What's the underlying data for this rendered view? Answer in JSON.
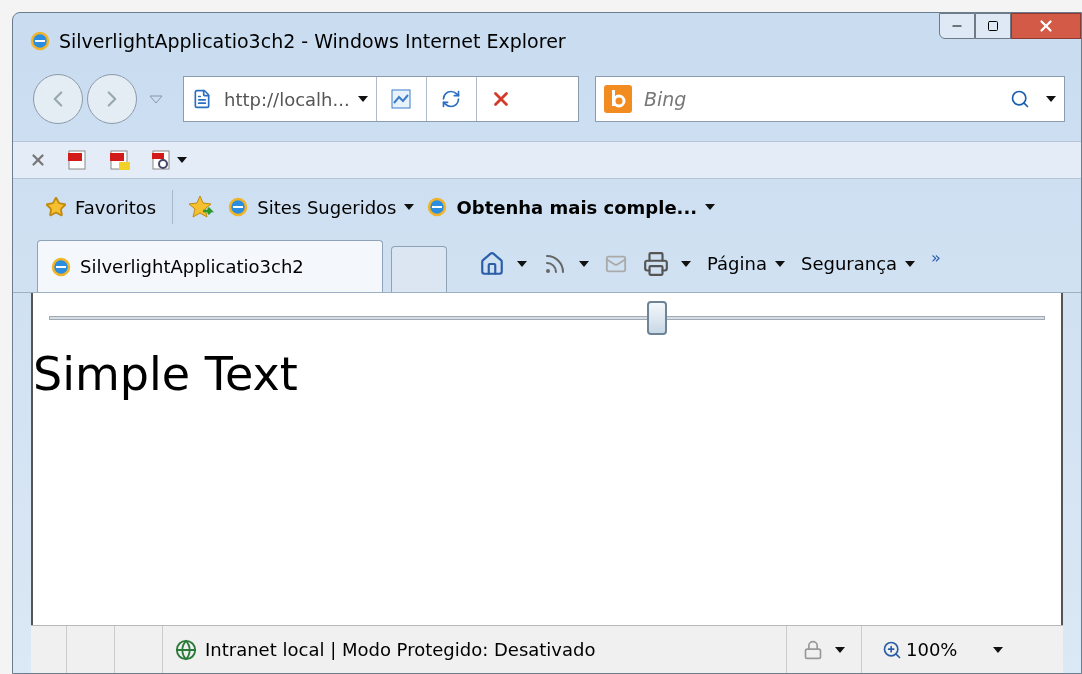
{
  "window": {
    "title": "SilverlightApplicatio3ch2 - Windows Internet Explorer"
  },
  "address": {
    "value": "http://localh..."
  },
  "search": {
    "placeholder": "Bing"
  },
  "favorites_bar": {
    "favorites": "Favoritos",
    "links": [
      {
        "label": "Sites Sugeridos",
        "bold": false
      },
      {
        "label": "Obtenha mais comple...",
        "bold": true
      }
    ]
  },
  "tabs": [
    {
      "kind": "page",
      "label": "SilverlightApplicatio3ch2",
      "selected": true
    },
    {
      "kind": "new",
      "selected": false
    }
  ],
  "command_bar": {
    "menus": [
      "Página",
      "Segurança"
    ],
    "overflow": "»"
  },
  "content": {
    "slider": {
      "level": 0.61
    },
    "text": "Simple Text"
  },
  "status_bar": {
    "zone": "Intranet local | Modo Protegido: Desativado",
    "zoom": "100%"
  }
}
